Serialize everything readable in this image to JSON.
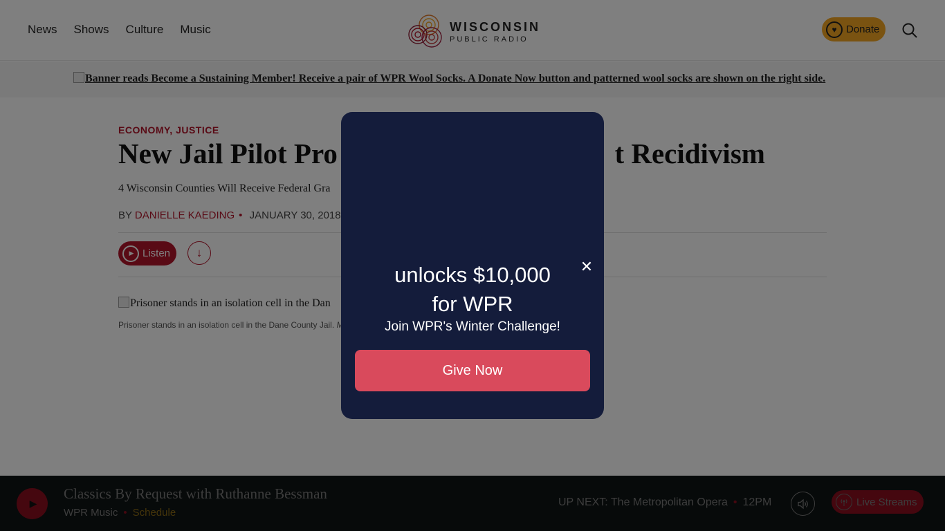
{
  "header": {
    "nav": [
      "News",
      "Shows",
      "Culture",
      "Music"
    ],
    "logo_line1": "WISCONSIN",
    "logo_line2": "PUBLIC RADIO",
    "donate_label": "Donate"
  },
  "banner": {
    "alt_text": "Banner reads Become a Sustaining Member! Receive a pair of WPR Wool Socks. A Donate Now button and patterned wool socks are shown on the right side."
  },
  "article": {
    "category": "ECONOMY, JUSTICE",
    "headline_left": "New Jail Pilot Pro",
    "headline_right": "t Recidivism",
    "deck": "4 Wisconsin Counties Will Receive Federal Gra",
    "byline_prefix": "BY",
    "author": "DANIELLE KAEDING",
    "date": "JANUARY 30, 2018",
    "listen_label": "Listen",
    "photo_alt": "Prisoner stands in an isolation cell in the Dan",
    "caption": "Prisoner stands in an isolation cell in the Dane County Jail.",
    "caption_credit": "M"
  },
  "modal": {
    "headline_line1": "unlocks $10,000",
    "headline_line2": "for WPR",
    "subtext": "Join WPR's Winter Challenge!",
    "button_label": "Give Now",
    "close_glyph": "✕"
  },
  "player": {
    "show_title": "Classics By Request with Ruthanne Bessman",
    "station": "WPR Music",
    "schedule_label": "Schedule",
    "up_next_label": "UP NEXT:",
    "up_next_show": "The Metropolitan Opera",
    "up_next_time": "12PM",
    "live_label": "Live Streams"
  },
  "colors": {
    "brand_red": "#b3152b",
    "donate_gold": "#f5a623",
    "modal_bg": "#141c3b",
    "give_button": "#d94a5c",
    "player_bg": "#0f1414"
  },
  "icons": [
    "wpr-logo-icon",
    "heart-icon",
    "search-icon",
    "play-icon",
    "download-icon",
    "close-icon",
    "volume-icon",
    "broadcast-icon"
  ]
}
